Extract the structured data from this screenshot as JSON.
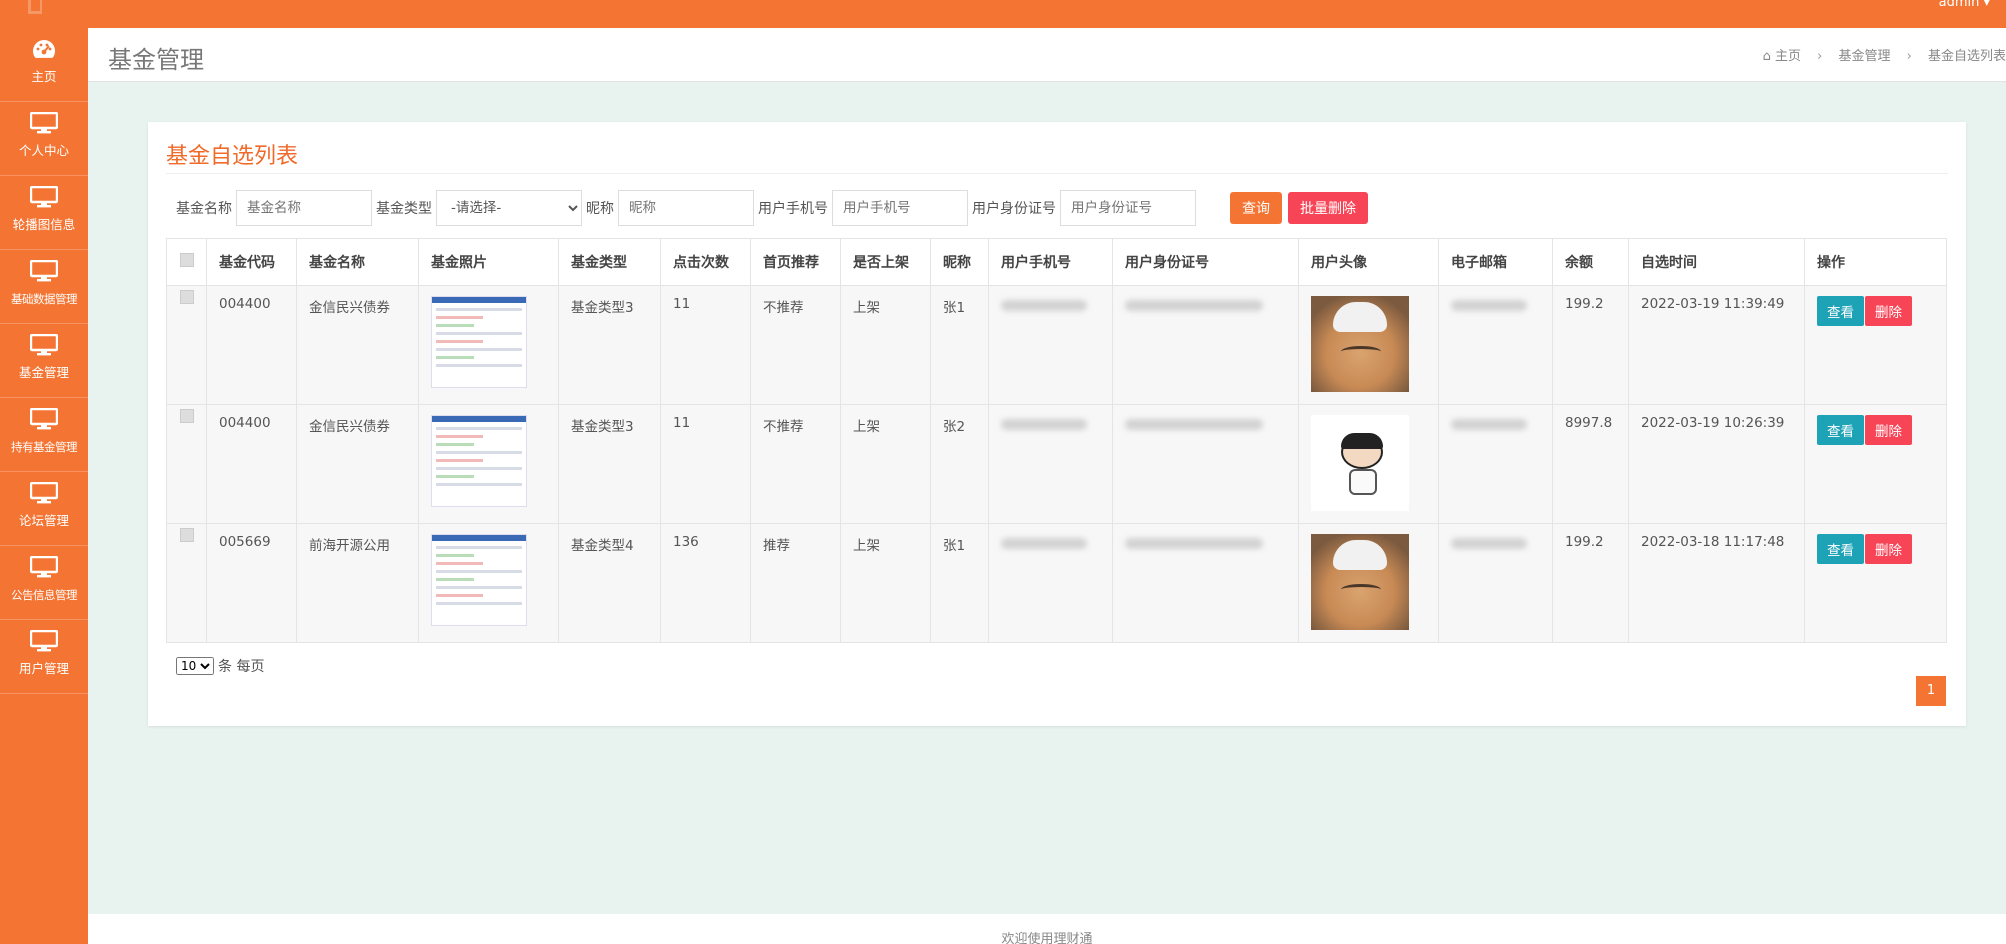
{
  "topbar": {
    "user": "admin ▾"
  },
  "sidebar": {
    "items": [
      {
        "label": "主页",
        "icon": "dashboard-icon"
      },
      {
        "label": "个人中心",
        "icon": "monitor-icon"
      },
      {
        "label": "轮播图信息",
        "icon": "monitor-icon"
      },
      {
        "label": "基础数据管理",
        "icon": "monitor-icon"
      },
      {
        "label": "基金管理",
        "icon": "monitor-icon"
      },
      {
        "label": "持有基金管理",
        "icon": "monitor-icon"
      },
      {
        "label": "论坛管理",
        "icon": "monitor-icon"
      },
      {
        "label": "公告信息管理",
        "icon": "monitor-icon"
      },
      {
        "label": "用户管理",
        "icon": "monitor-icon"
      }
    ]
  },
  "header": {
    "title": "基金管理",
    "breadcrumb": [
      "主页",
      "基金管理",
      "基金自选列表"
    ]
  },
  "card": {
    "title": "基金自选列表"
  },
  "filters": {
    "fund_name_label": "基金名称",
    "fund_name_placeholder": "基金名称",
    "fund_type_label": "基金类型",
    "fund_type_selected": "-请选择-",
    "nickname_label": "昵称",
    "nickname_placeholder": "昵称",
    "phone_label": "用户手机号",
    "phone_placeholder": "用户手机号",
    "idcard_label": "用户身份证号",
    "idcard_placeholder": "用户身份证号",
    "search_label": "查询",
    "batch_delete_label": "批量删除"
  },
  "table": {
    "headers": [
      "基金代码",
      "基金名称",
      "基金照片",
      "基金类型",
      "点击次数",
      "首页推荐",
      "是否上架",
      "昵称",
      "用户手机号",
      "用户身份证号",
      "用户头像",
      "电子邮箱",
      "余额",
      "自选时间",
      "操作"
    ],
    "rows": [
      {
        "code": "004400",
        "name": "金信民兴债券",
        "type": "基金类型3",
        "clicks": "11",
        "recommend": "不推荐",
        "listed": "上架",
        "nickname": "张1",
        "balance": "199.2",
        "time": "2022-03-19 11:39:49",
        "avatar": "cat"
      },
      {
        "code": "004400",
        "name": "金信民兴债券",
        "type": "基金类型3",
        "clicks": "11",
        "recommend": "不推荐",
        "listed": "上架",
        "nickname": "张2",
        "balance": "8997.8",
        "time": "2022-03-19 10:26:39",
        "avatar": "cartoon"
      },
      {
        "code": "005669",
        "name": "前海开源公用",
        "type": "基金类型4",
        "clicks": "136",
        "recommend": "推荐",
        "listed": "上架",
        "nickname": "张1",
        "balance": "199.2",
        "time": "2022-03-18 11:17:48",
        "avatar": "cat"
      }
    ],
    "view_label": "查看",
    "delete_label": "删除"
  },
  "pagination": {
    "page_size": "10",
    "per_page_label": "条 每页",
    "current_page": "1"
  },
  "footer": {
    "text": "欢迎使用理财通"
  },
  "colors": {
    "accent": "#f47533",
    "danger": "#f74557",
    "teal": "#1ea2b6"
  }
}
